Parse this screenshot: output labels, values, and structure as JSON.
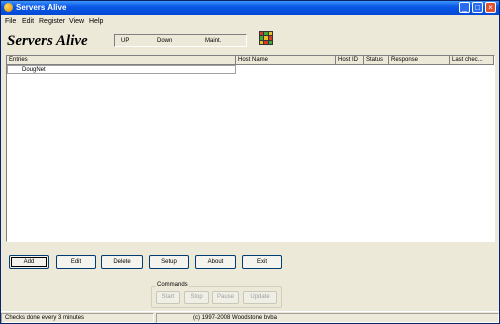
{
  "window": {
    "title": "Servers Alive",
    "controls": {
      "minimize": "_",
      "maximize": "□",
      "close": "×"
    }
  },
  "menu": {
    "items": [
      "File",
      "Edit",
      "Register",
      "View",
      "Help"
    ]
  },
  "header": {
    "logo_text": "Servers Alive",
    "status": {
      "up": "UP",
      "down": "Down",
      "maint": "Maint."
    }
  },
  "grid_icon_colors": [
    "#d83a2a",
    "#3aa83a",
    "#e8c020",
    "#3aa83a",
    "#e8c020",
    "#d83a2a",
    "#e8c020",
    "#d83a2a",
    "#3aa83a"
  ],
  "table": {
    "columns": [
      "Entries",
      "Host Name",
      "Host ID",
      "Status",
      "Response",
      "Last chec..."
    ],
    "entries": [
      "DougNet"
    ]
  },
  "buttons": {
    "add": "Add",
    "edit": "Edit",
    "delete": "Delete",
    "setup": "Setup",
    "about": "About",
    "exit": "Exit"
  },
  "commands": {
    "label": "Commands",
    "start": "Start",
    "stop": "Stop",
    "pause": "Pause",
    "update": "Update"
  },
  "statusbar": {
    "checks": "Checks done every  3 minutes",
    "copyright": "(c) 1997-2008 Woodstone bvba"
  }
}
